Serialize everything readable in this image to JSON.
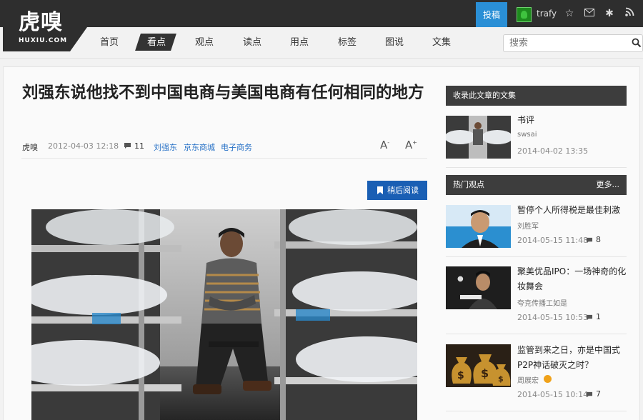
{
  "brand": {
    "name": "虎嗅",
    "sub": "HUXIU.COM"
  },
  "topbar": {
    "submit_label": "投稿",
    "username": "trafy",
    "icons": [
      "star-icon",
      "mail-icon",
      "gear-icon",
      "rss-icon"
    ]
  },
  "nav": {
    "items": [
      "首页",
      "看点",
      "观点",
      "读点",
      "用点",
      "标签",
      "图说",
      "文集"
    ],
    "active": "看点"
  },
  "search": {
    "placeholder": "搜索"
  },
  "article": {
    "title": "刘强东说他找不到中国电商与美国电商有任何相同的地方",
    "source": "虎嗅",
    "date": "2012-04-03 12:18",
    "comments": "11",
    "tags": [
      "刘强东",
      "京东商城",
      "电子商务"
    ],
    "font_smaller": "A",
    "font_larger": "A",
    "read_later": "稍后阅读"
  },
  "sidebar": {
    "collected": {
      "heading": "收录此文章的文集",
      "items": [
        {
          "title": "书评",
          "author": "swsai",
          "date": "2014-04-02 13:35"
        }
      ]
    },
    "hot": {
      "heading": "热门观点",
      "more": "更多...",
      "items": [
        {
          "title": "暂停个人所得税是最佳刺激",
          "author": "刘胜军",
          "date": "2014-05-15 11:48",
          "comments": "8"
        },
        {
          "title": "聚美优品IPO：一场神奇的化妆舞会",
          "author": "夸克传播工如是",
          "date": "2014-05-15 10:53",
          "comments": "1"
        },
        {
          "title": "监管到来之日，亦是中国式P2P神话破灭之时？",
          "author": "周展宏",
          "date": "2014-05-15 10:14",
          "comments": "7"
        }
      ]
    }
  },
  "colors": {
    "accent": "#2a8fd6",
    "button": "#1a5fb4",
    "dark": "#2e2e2e",
    "link": "#2a73c7"
  }
}
